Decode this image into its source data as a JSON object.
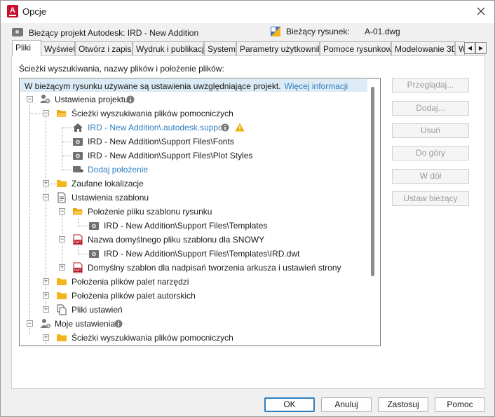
{
  "window": {
    "title": "Opcje",
    "app_icon_letter": "A"
  },
  "project": {
    "label": "Bieżący projekt Autodesk: IRD - New Addition",
    "drawing_label": "Bieżący rysunek:",
    "drawing_value": "A-01.dwg"
  },
  "tabs": [
    {
      "label": "Pliki",
      "active": true
    },
    {
      "label": "Wyświetl"
    },
    {
      "label": "Otwórz i zapisz"
    },
    {
      "label": "Wydruk i publikacja"
    },
    {
      "label": "System"
    },
    {
      "label": "Parametry użytkownika"
    },
    {
      "label": "Pomoce rysunkowe"
    },
    {
      "label": "Modelowanie 3D"
    },
    {
      "label": "W"
    }
  ],
  "panel": {
    "label": "Ścieżki wyszukiwania, nazwy plików i położenie plików:",
    "info_text": "W bieżącym rysunku używane są ustawienia uwzględniające projekt.",
    "info_link": "Więcej informacji"
  },
  "tree": [
    {
      "label": "Ustawienia projektu",
      "level": 0,
      "icon": "people-gear-icon",
      "info": true
    },
    {
      "label": "Ścieżki wyszukiwania plików pomocniczych",
      "level": 1,
      "icon": "folder-open-icon"
    },
    {
      "label": "IRD - New Addition\\.autodesk.support",
      "level": 2,
      "icon": "home-icon",
      "link": true,
      "info": true,
      "warn": true
    },
    {
      "label": "IRD - New Addition\\Support Files\\Fonts",
      "level": 2,
      "icon": "camera-folder-icon"
    },
    {
      "label": "IRD - New Addition\\Support Files\\Plot Styles",
      "level": 2,
      "icon": "camera-folder-icon"
    },
    {
      "label": "Dodaj położenie",
      "level": 2,
      "icon": "add-location-icon",
      "link": true
    },
    {
      "label": "Zaufane lokalizacje",
      "level": 1,
      "icon": "folder-icon"
    },
    {
      "label": "Ustawienia szablonu",
      "level": 1,
      "icon": "document-icon"
    },
    {
      "label": "Położenie pliku szablonu rysunku",
      "level": 2,
      "icon": "folder-open-icon"
    },
    {
      "label": "IRD - New Addition\\Support Files\\Templates",
      "level": 3,
      "icon": "camera-folder-icon"
    },
    {
      "label": "Nazwa domyślnego pliku szablonu dla SNOWY",
      "level": 2,
      "icon": "dwt-icon"
    },
    {
      "label": "IRD - New Addition\\Support Files\\Templates\\IRD.dwt",
      "level": 3,
      "icon": "camera-folder-icon"
    },
    {
      "label": "Domyślny szablon dla nadpisań tworzenia arkusza i ustawień strony",
      "level": 2,
      "icon": "dwt-icon"
    },
    {
      "label": "Położenia plików palet narzędzi",
      "level": 1,
      "icon": "folder-icon"
    },
    {
      "label": "Położenia plików palet autorskich",
      "level": 1,
      "icon": "folder-icon"
    },
    {
      "label": "Pliki ustawień",
      "level": 1,
      "icon": "copy-files-icon"
    },
    {
      "label": "Moje ustawienia",
      "level": 0,
      "icon": "person-gear-icon",
      "info": true
    },
    {
      "label": "Ścieżki wyszukiwania plików pomocniczych",
      "level": 1,
      "icon": "folder-icon"
    }
  ],
  "side_buttons": [
    "Przeglądaj...",
    "Dodaj...",
    "Usuń",
    "Do góry",
    "W dół",
    "Ustaw bieżący"
  ],
  "bottom_buttons": {
    "ok": "OK",
    "cancel": "Anuluj",
    "apply": "Zastosuj",
    "help": "Pomoc"
  },
  "colors": {
    "link": "#2f7fc0",
    "folder": "#f2b51c",
    "warning": "#f0a800",
    "info_bar": "#dcebf5",
    "dwt": "#b5121b"
  }
}
